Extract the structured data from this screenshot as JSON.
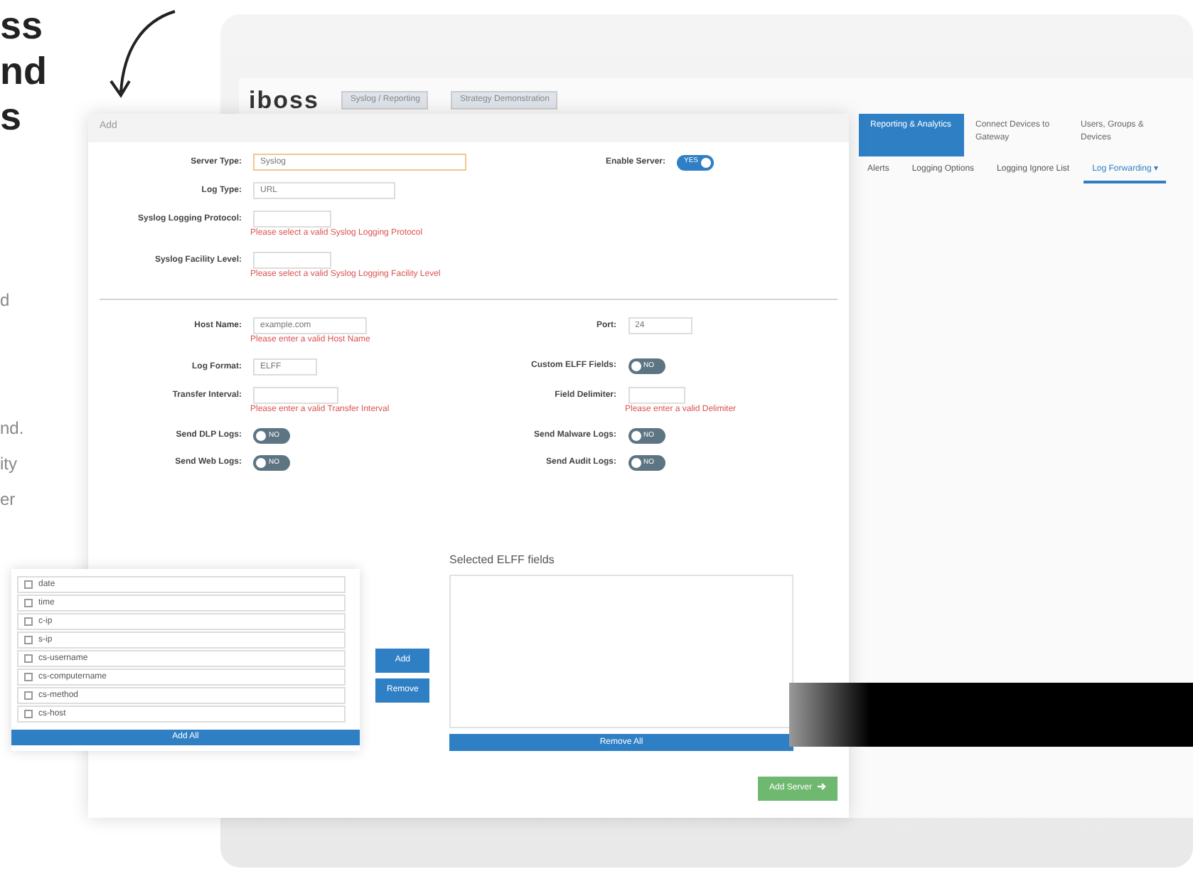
{
  "headline": [
    "ss",
    "nd",
    "s"
  ],
  "side_text": [
    "d",
    "nd.",
    "ity",
    "er"
  ],
  "app": {
    "logo": "iboss",
    "path_select": "Syslog / Reporting",
    "account_select": "Strategy Demonstration",
    "nav": [
      {
        "label": "Reporting & Analytics",
        "selected": true
      },
      {
        "label": "Connect Devices to Gateway",
        "selected": false
      },
      {
        "label": "Users, Groups & Devices",
        "selected": false
      }
    ],
    "subnav": [
      {
        "label": "Alerts",
        "selected": false
      },
      {
        "label": "Logging Options",
        "selected": false
      },
      {
        "label": "Logging Ignore List",
        "selected": false
      },
      {
        "label": "Log Forwarding ▾",
        "selected": true
      }
    ]
  },
  "dialog": {
    "title": "Add",
    "server_type": {
      "label": "Server Type:",
      "value": "Syslog"
    },
    "enable_server": {
      "label": "Enable Server:",
      "on": true,
      "text": "YES"
    },
    "log_type": {
      "label": "Log Type:",
      "value": "URL"
    },
    "protocol": {
      "label": "Syslog Logging Protocol:",
      "error": "Please select a valid Syslog Logging Protocol"
    },
    "facility": {
      "label": "Syslog Facility Level:",
      "error": "Please select a valid Syslog Logging Facility Level"
    },
    "host": {
      "label": "Host Name:",
      "placeholder": "example.com",
      "error": "Please enter a valid Host Name"
    },
    "port": {
      "label": "Port:",
      "value": "24"
    },
    "log_format": {
      "label": "Log Format:",
      "value": "ELFF"
    },
    "custom_elff": {
      "label": "Custom ELFF Fields:",
      "on": false,
      "text": "NO"
    },
    "interval": {
      "label": "Transfer Interval:",
      "error": "Please enter a valid Transfer Interval"
    },
    "delimiter": {
      "label": "Field Delimiter:",
      "error": "Please enter a valid Delimiter"
    },
    "toggles": [
      {
        "label": "Send DLP Logs:",
        "on": false,
        "text": "NO"
      },
      {
        "label": "Send Malware Logs:",
        "on": false,
        "text": "NO"
      },
      {
        "label": "Send Web Logs:",
        "on": false,
        "text": "NO"
      },
      {
        "label": "Send Audit Logs:",
        "on": false,
        "text": "NO"
      }
    ],
    "fields": [
      {
        "name": "date",
        "checked": false
      },
      {
        "name": "time",
        "checked": false
      },
      {
        "name": "c-ip",
        "checked": false
      },
      {
        "name": "s-ip",
        "checked": false
      },
      {
        "name": "cs-username",
        "checked": false
      },
      {
        "name": "cs-computername",
        "checked": false
      },
      {
        "name": "cs-method",
        "checked": false
      },
      {
        "name": "cs-host",
        "checked": false
      }
    ],
    "add_all": "Add All",
    "add": "Add",
    "remove": "Remove",
    "selected_title": "Selected ELFF fields",
    "remove_all": "Remove All",
    "submit": "Add Server"
  }
}
